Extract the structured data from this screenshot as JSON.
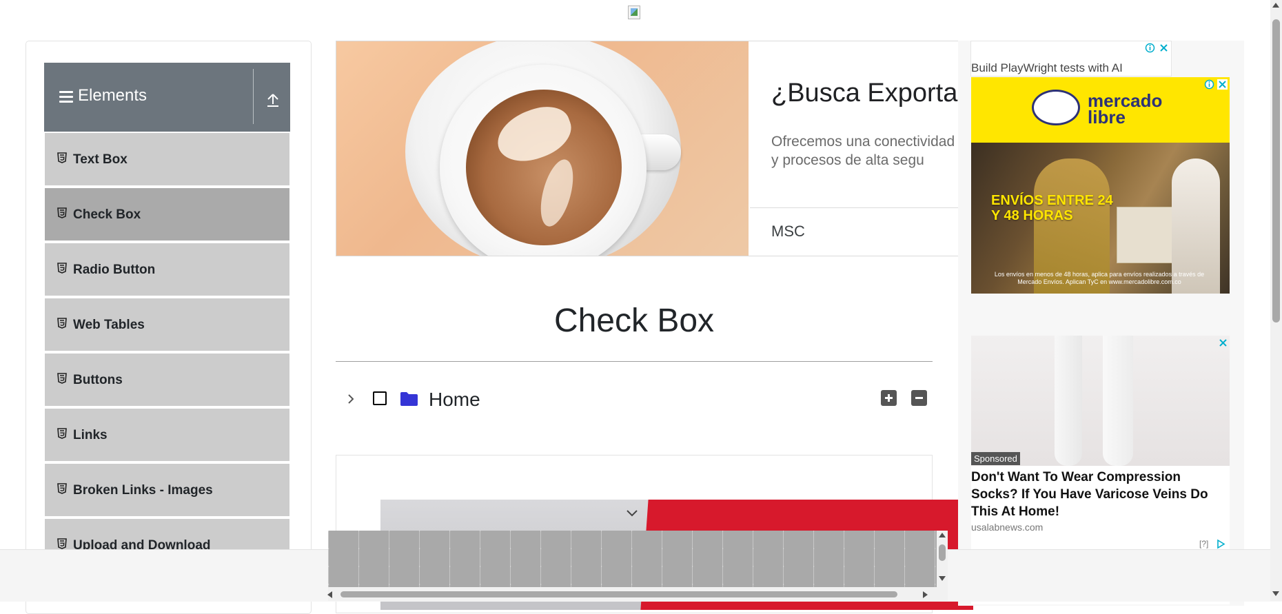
{
  "sidebar": {
    "group_title": "Elements",
    "items": [
      {
        "label": "Text Box"
      },
      {
        "label": "Check Box"
      },
      {
        "label": "Radio Button"
      },
      {
        "label": "Web Tables"
      },
      {
        "label": "Buttons"
      },
      {
        "label": "Links"
      },
      {
        "label": "Broken Links - Images"
      },
      {
        "label": "Upload and Download"
      }
    ],
    "active_item": "Check Box"
  },
  "banner_ad": {
    "title": "¿Busca Exportar C",
    "description": "Ofrecemos una conectividad clase y procesos de alta segu",
    "brand": "MSC"
  },
  "main": {
    "page_title": "Check Box",
    "tree": {
      "root_label": "Home",
      "checked": false,
      "expanded": false
    }
  },
  "right_ads": {
    "broken_image_alt": "Build PlayWright tests with AI",
    "mercadolibre": {
      "logo_text": "mercado libre",
      "headline": "ENVÍOS ENTRE 24 Y 48 HORAS",
      "fine_print": "Los envíos en menos de 48 horas, aplica para envíos realizados a través de Mercado Envíos. Aplican TyC en www.mercadolibre.com.co"
    },
    "sock_ad": {
      "badge": "Sponsored",
      "headline": "Don't Want To Wear Compression Socks? If You Have Varicose Veins Do This At Home!",
      "source": "usalabnews.com",
      "help": "[?]"
    }
  },
  "colors": {
    "sidebar_header": "#6c757d",
    "menu_item": "#cccccc",
    "menu_item_active": "#aaaaaa",
    "folder_icon": "#3535d6",
    "mercadolibre_yellow": "#ffe600",
    "adchoices_blue": "#00aecd"
  },
  "icons": {
    "menu": "hamburger-icon",
    "collapse_group": "upload-arrow-icon",
    "item": "html5-icon",
    "tree_toggle": "chevron-right-icon",
    "folder": "folder-icon",
    "expand_all": "plus-square-icon",
    "collapse_all": "minus-square-icon"
  }
}
